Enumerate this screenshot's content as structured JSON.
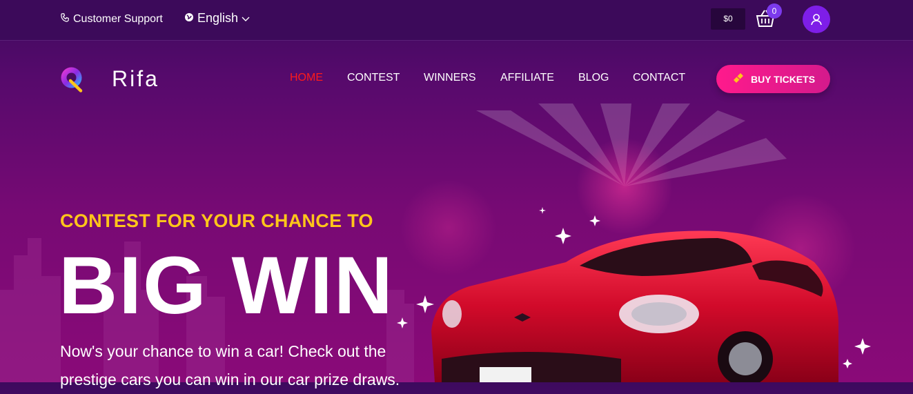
{
  "topbar": {
    "support_label": "Customer Support",
    "language": "English",
    "balance": "$0",
    "cart_count": "0"
  },
  "brand": {
    "name": "Rifa"
  },
  "nav": {
    "items": [
      "HOME",
      "CONTEST",
      "WINNERS",
      "AFFILIATE",
      "BLOG",
      "CONTACT"
    ],
    "active_color": "#ff1a1a",
    "buy_label": "BUY TICKETS"
  },
  "hero": {
    "eyebrow": "CONTEST FOR YOUR CHANCE TO",
    "headline": "BIG WIN",
    "description": "Now's your chance to win a car! Check out the prestige cars you can win in our car prize draws."
  },
  "colors": {
    "accent_yellow": "#ffc61a",
    "buy_pink": "#ff1a8c",
    "user_purple": "#7e1ee8"
  }
}
